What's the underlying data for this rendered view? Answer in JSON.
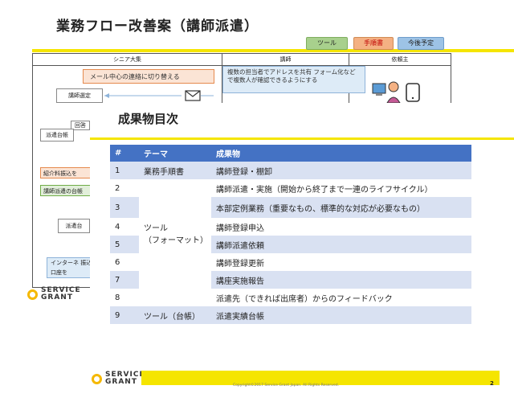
{
  "background_slide": {
    "title": "業務フロー改善案（講師派遣）",
    "tags": [
      "ツール",
      "手順書",
      "今後予定"
    ],
    "lane_headers": [
      "シニア大集",
      "講師",
      "依頼主"
    ],
    "callout_orange": "メール中心の連絡に切り替える",
    "callout_blue": "複数の担当者でアドレスを共有 フォーム化などで複数人が確認できるようにする",
    "box_select": "講師選定",
    "box_answer": "回答",
    "box_ledger": "派遣台帳",
    "side_orange": "紹介料振込を",
    "side_green": "講師派遣の台帳",
    "box_ledger2": "派遣台",
    "side_blue": "インターネ 振込口座を",
    "logo_line1": "SERVICE",
    "logo_line2": "GRANT"
  },
  "overlay": {
    "title": "成果物目次",
    "headers": [
      "#",
      "テーマ",
      "成果物"
    ],
    "rows": [
      {
        "num": "1",
        "deliverable": "講師登録・棚卸"
      },
      {
        "num": "2",
        "deliverable": "講師派遣・実施（開始から終了まで一連のライフサイクル）"
      },
      {
        "num": "3",
        "deliverable": "本部定例業務（重要なもの、標準的な対応が必要なもの）"
      },
      {
        "num": "4",
        "deliverable": "講師登録申込"
      },
      {
        "num": "5",
        "deliverable": "講師派遣依頼"
      },
      {
        "num": "6",
        "deliverable": "講師登録更新"
      },
      {
        "num": "7",
        "deliverable": "講座実施報告"
      },
      {
        "num": "8",
        "deliverable": "派遣先（できれば出席者）からのフィードバック"
      },
      {
        "num": "9",
        "deliverable": "派遣実績台帳"
      }
    ],
    "themes": {
      "a": "業務手順書",
      "b_line1": "ツール",
      "b_line2": "（フォーマット）",
      "c": "ツール（台帳）"
    }
  },
  "footer": {
    "logo_line1": "SERVICE",
    "logo_line2": "GRANT",
    "copyright": "Copyright©2017 Service Grant Japan. All Rights Reserved.",
    "page_number": "2"
  },
  "colors": {
    "accent_yellow": "#f5e500",
    "table_header": "#4472c4",
    "table_band": "#d9e1f2",
    "logo_ring": "#f5b800"
  }
}
